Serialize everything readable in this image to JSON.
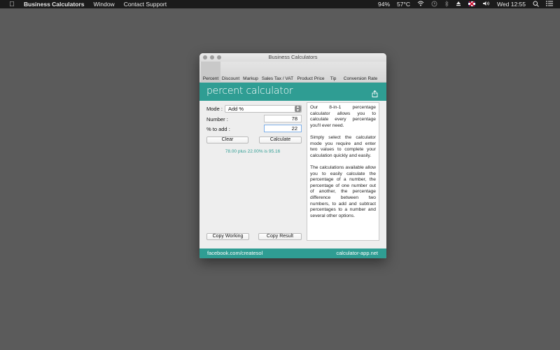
{
  "menubar": {
    "app_name": "Business Calculators",
    "menus": [
      "Window",
      "Contact Support"
    ],
    "battery": "94%",
    "temperature": "57°C",
    "clock": "Wed 12:55"
  },
  "window": {
    "title": "Business Calculators",
    "tabs": [
      {
        "label": "Percent",
        "active": true
      },
      {
        "label": "Discount"
      },
      {
        "label": "Markup"
      },
      {
        "label": "Sales Tax / VAT"
      },
      {
        "label": "Product Price"
      },
      {
        "label": "Tip"
      },
      {
        "label": "Conversion Rate"
      }
    ],
    "header_title": "percent calculator",
    "accent_color": "#2f9d93"
  },
  "form": {
    "mode_label": "Mode :",
    "mode_value": "Add %",
    "number_label": "Number :",
    "number_value": "78",
    "percent_label": "% to add :",
    "percent_value": "22",
    "clear_label": "Clear",
    "calculate_label": "Calculate",
    "result_text": "78.00 plus 22.00% is 95.16",
    "copy_working_label": "Copy Working",
    "copy_result_label": "Copy Result"
  },
  "description": {
    "p1": "Our 8-in-1 percentage calculator allows you to calculate every percentage you'll ever need.",
    "p2": "Simply select the calculator mode you require and enter two values to complete your calculation quickly and easily.",
    "p3": "The calculations available allow you to easily calculate the percentage of a number, the percentage of one number out of another, the percentage difference between two numbers, to add and subtract percentages to a number and several other options."
  },
  "footer": {
    "left_link": "facebook.com/createsol",
    "right_link": "calculator-app.net"
  }
}
